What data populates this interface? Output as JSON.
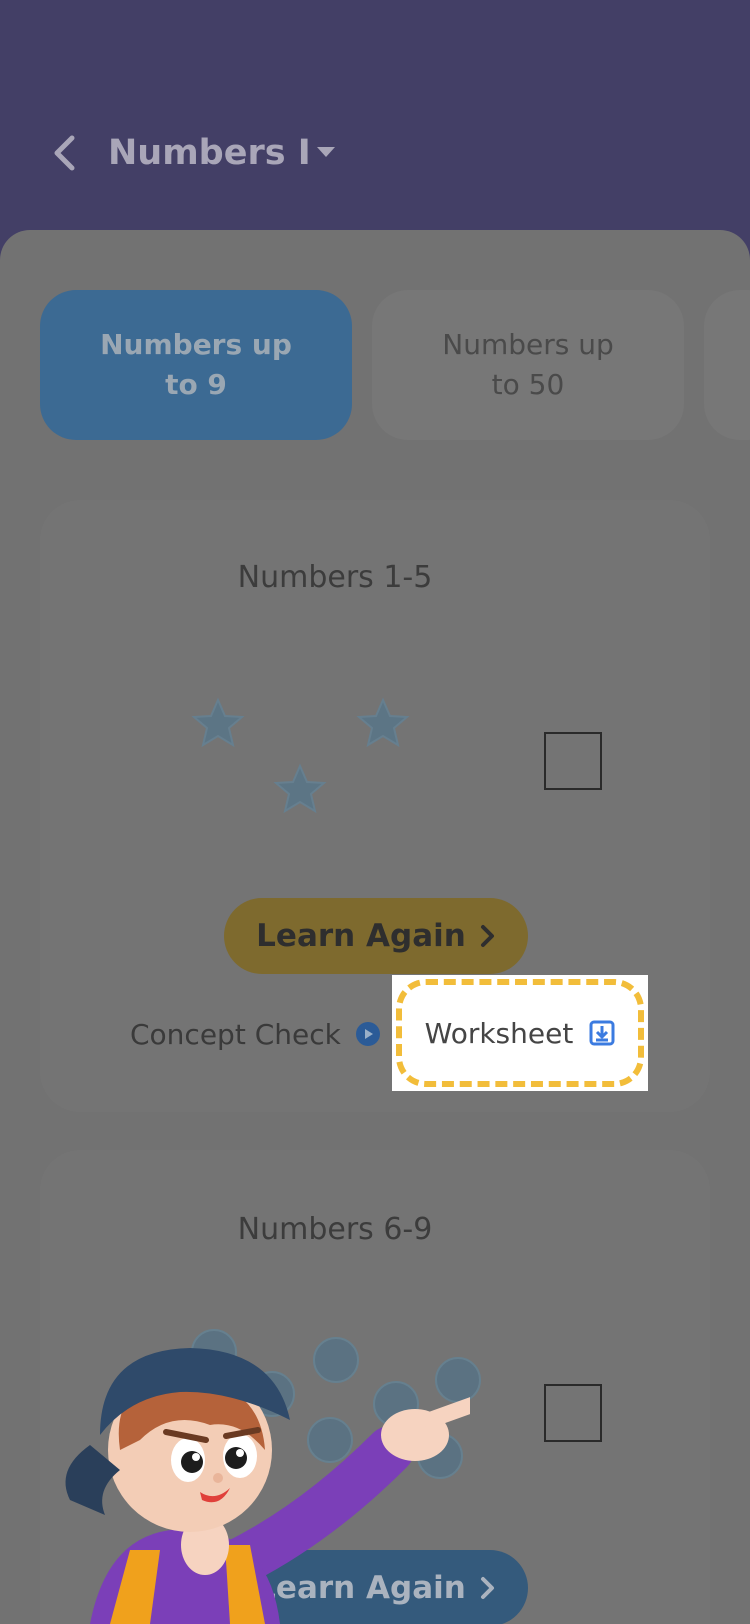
{
  "header": {
    "title": "Numbers I",
    "back_icon": "chevron-left-icon",
    "dropdown_icon": "caret-down-icon"
  },
  "tabs": [
    {
      "label": "Numbers up\nto 9",
      "active": true
    },
    {
      "label": "Numbers up\nto 50",
      "active": false
    }
  ],
  "cards": [
    {
      "title": "Numbers 1-5",
      "illustration": "stars",
      "learn_label": "Learn Again",
      "concept_label": "Concept Check",
      "worksheet_label": "Worksheet"
    },
    {
      "title": "Numbers 6-9",
      "illustration": "circles",
      "learn_label": "Learn Again"
    }
  ],
  "colors": {
    "header_bg": "#433f66",
    "tab_active": "#3c6a93",
    "learn_btn_1": "#7e6a2e",
    "learn_btn_2": "#345a7c",
    "highlight_dash": "#f2bd3a",
    "worksheet_icon": "#3b7be0",
    "concept_icon": "#2b5b97"
  }
}
